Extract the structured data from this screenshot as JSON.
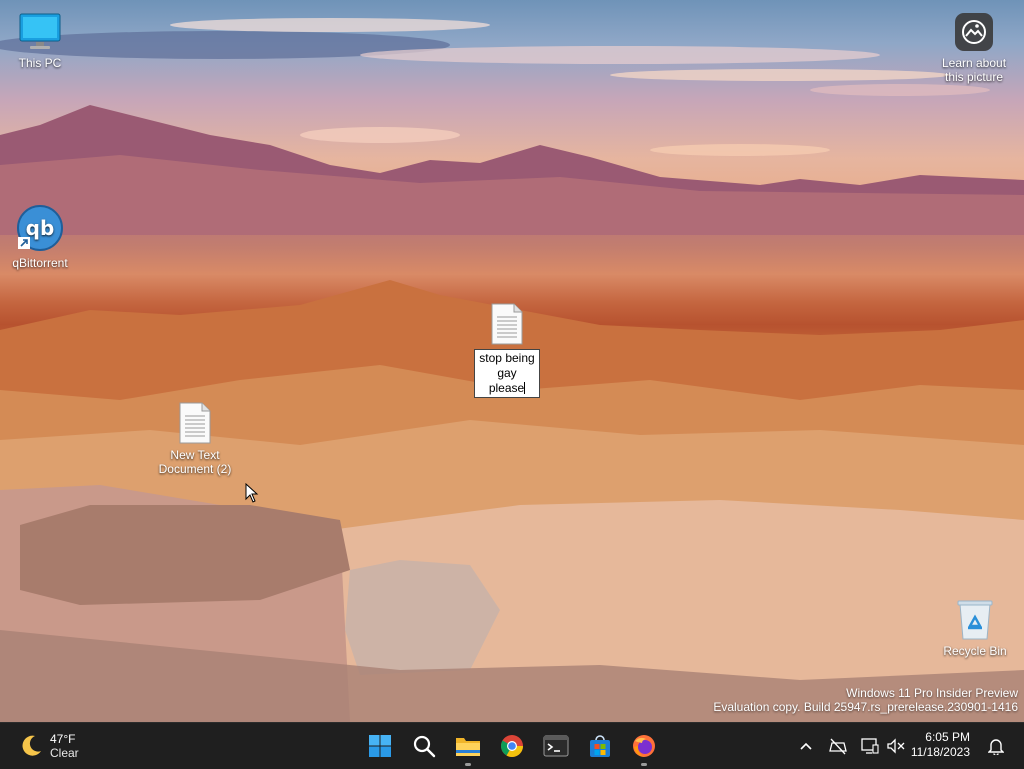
{
  "desktop": {
    "icons": [
      {
        "label": "This PC"
      },
      {
        "label": "qBittorrent"
      },
      {
        "label": "New Text Document (2)"
      },
      {
        "label": "Recycle Bin"
      }
    ],
    "rename_icon": {
      "value": "stop being gay please"
    },
    "learn": {
      "label": "Learn about this picture"
    },
    "watermark": {
      "line1": "Windows 11 Pro Insider Preview",
      "line2": "Evaluation copy. Build 25947.rs_prerelease.230901-1416"
    }
  },
  "taskbar": {
    "weather": {
      "temp": "47°F",
      "condition": "Clear",
      "icon": "moon-icon"
    },
    "apps": [
      {
        "name": "start-button",
        "icon": "windows-logo-icon"
      },
      {
        "name": "search-button",
        "icon": "search-icon"
      },
      {
        "name": "file-explorer-button",
        "icon": "folder-icon"
      },
      {
        "name": "chrome-button",
        "icon": "chrome-icon"
      },
      {
        "name": "terminal-button",
        "icon": "terminal-icon"
      },
      {
        "name": "store-button",
        "icon": "store-icon"
      },
      {
        "name": "firefox-button",
        "icon": "firefox-icon"
      }
    ],
    "tray": [
      "chevron-up-icon",
      "network-icon",
      "display-icon",
      "volume-muted-icon"
    ],
    "clock": {
      "time": "6:05 PM",
      "date": "11/18/2023"
    },
    "notification_icon": "bell-icon"
  },
  "colors": {
    "taskbar": "#1f1f1f",
    "accent": "#0078d4",
    "qbittorrent": "#3a8fd6"
  }
}
